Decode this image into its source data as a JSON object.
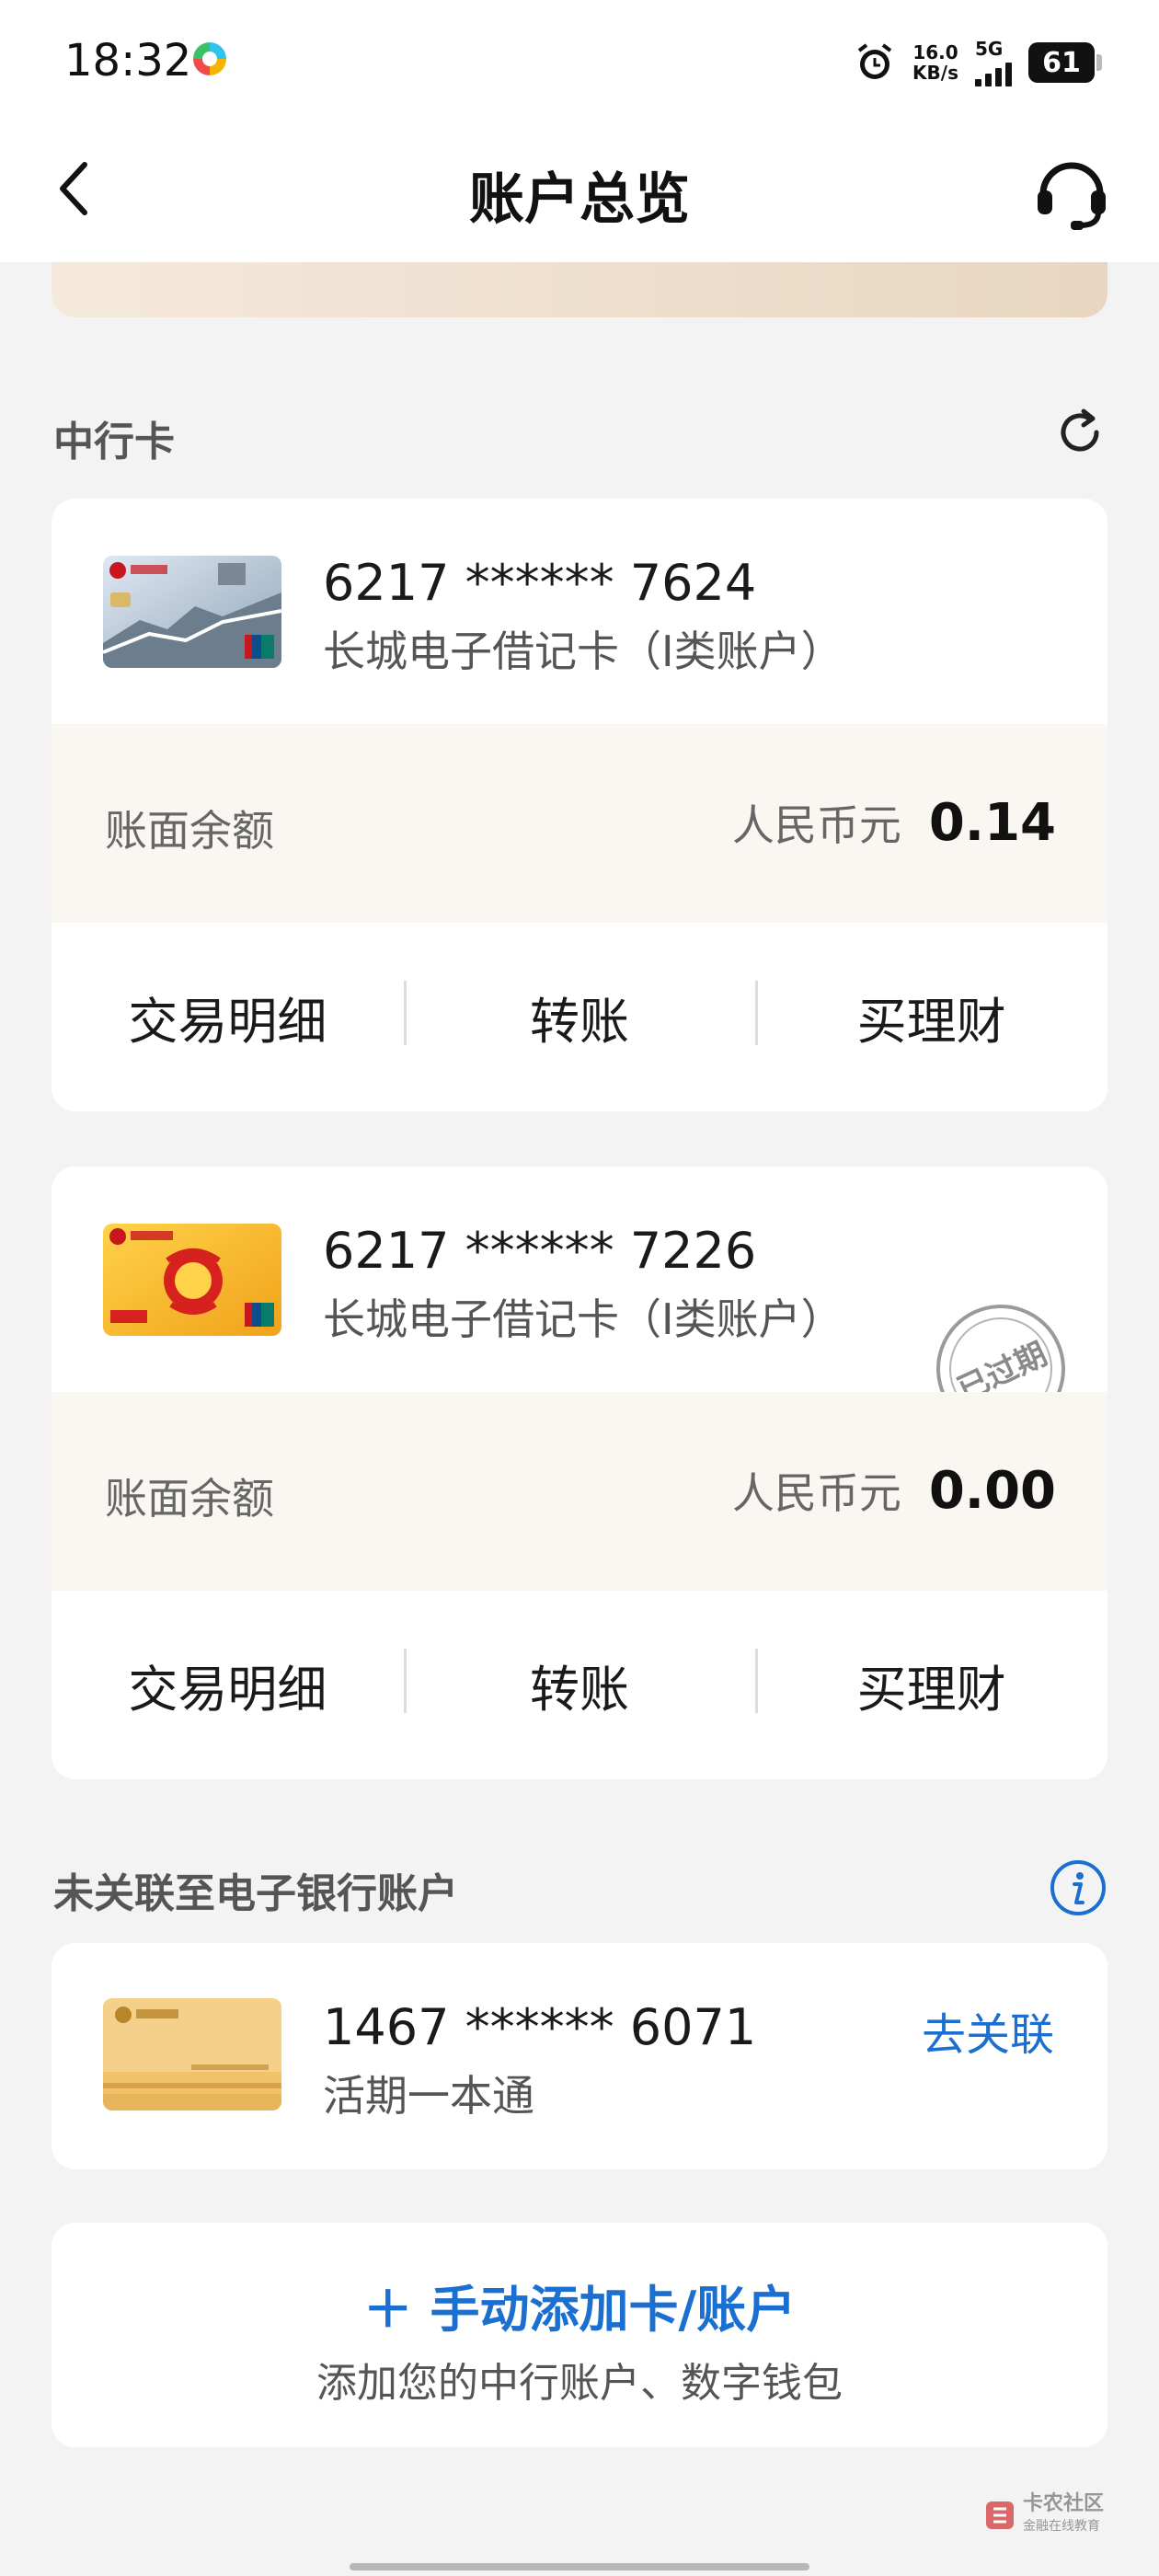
{
  "status_bar": {
    "time": "18:32",
    "speed_value": "16.0",
    "speed_unit": "KB/s",
    "network": "5G",
    "battery": "61"
  },
  "header": {
    "title": "账户总览",
    "back_icon": "chevron-left-icon",
    "service_icon": "headset-icon"
  },
  "section_boc": {
    "title": "中行卡",
    "refresh_icon": "refresh-icon"
  },
  "cards": [
    {
      "number": "6217 ****** 7624",
      "type": "长城电子借记卡（I类账户）",
      "balance_label": "账面余额",
      "currency": "人民币元",
      "balance": "0.14",
      "actions": [
        "交易明细",
        "转账",
        "买理财"
      ],
      "expired": false
    },
    {
      "number": "6217 ****** 7226",
      "type": "长城电子借记卡（I类账户）",
      "balance_label": "账面余额",
      "currency": "人民币元",
      "balance": "0.00",
      "actions": [
        "交易明细",
        "转账",
        "买理财"
      ],
      "expired": true,
      "stamp_text": "已过期"
    }
  ],
  "section_unlinked": {
    "title": "未关联至电子银行账户",
    "info_icon": "info-icon",
    "account": {
      "number": "1467 ****** 6071",
      "type": "活期一本通",
      "link_label": "去关联"
    }
  },
  "add_account": {
    "title": "＋ 手动添加卡/账户",
    "subtitle": "添加您的中行账户、数字钱包"
  },
  "watermark": {
    "line1": "卡农社区",
    "line2": "金融在线教育"
  },
  "colors": {
    "accent": "#1a6fd0",
    "balance_bg": "#faf6f1",
    "page_bg": "#f3f3f3"
  }
}
